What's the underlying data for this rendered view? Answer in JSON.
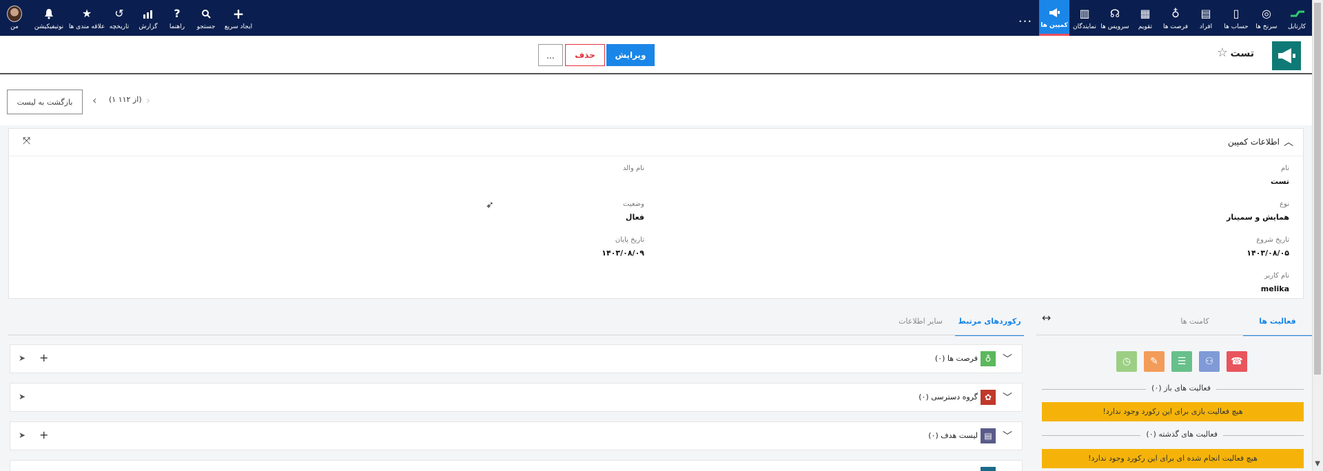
{
  "nav": {
    "right_items": [
      {
        "label": "کارتابل",
        "icon": "dashboard-icon"
      },
      {
        "label": "سرنخ ها",
        "icon": "target-icon"
      },
      {
        "label": "حساب ها",
        "icon": "building-icon"
      },
      {
        "label": "افراد",
        "icon": "contact-card-icon"
      },
      {
        "label": "فرصت ها",
        "icon": "lightbulb-icon"
      },
      {
        "label": "تقویم",
        "icon": "calendar-icon"
      },
      {
        "label": "سرویس ها",
        "icon": "headset-icon"
      },
      {
        "label": "نمایندگان",
        "icon": "agents-icon"
      },
      {
        "label": "کمپین ها",
        "icon": "megaphone-icon"
      }
    ],
    "left_items": [
      {
        "label": "من",
        "icon": "avatar"
      },
      {
        "label": "نوتیفیکیشن",
        "icon": "bell-icon"
      },
      {
        "label": "علاقه مندی ها",
        "icon": "star-icon"
      },
      {
        "label": "تاریخچه",
        "icon": "history-icon"
      },
      {
        "label": "گزارش",
        "icon": "chart-icon"
      },
      {
        "label": "راهنما",
        "icon": "help-icon"
      },
      {
        "label": "جستجو",
        "icon": "search-icon"
      },
      {
        "label": "ایجاد سریع",
        "icon": "plus-icon"
      }
    ],
    "more": "..."
  },
  "header": {
    "title": "تست",
    "edit_label": "ویرایش",
    "delete_label": "حذف",
    "more_label": "..."
  },
  "pager": {
    "back_label": "بازگشت به لیست",
    "count": "(۱ از ۱۱۲)"
  },
  "panel": {
    "title": "اطلاعات کمپین",
    "fields": {
      "name_label": "نام",
      "name_value": "تست",
      "type_label": "نوع",
      "type_value": "همایش و سمینار",
      "start_label": "تاریخ شروع",
      "start_value": "۱۴۰۳/۰۸/۰۵",
      "user_label": "نام کاربر",
      "user_value": "melika",
      "parent_label": "نام والد",
      "parent_value": "",
      "status_label": "وضعیت",
      "status_value": "فعال",
      "end_label": "تاریخ پایان",
      "end_value": "۱۴۰۳/۰۸/۰۹"
    }
  },
  "tabs": {
    "activities": "فعالیت ها",
    "comments": "کامنت ها",
    "related": "رکوردهای مرتبط",
    "other": "سایر اطلاعات"
  },
  "related": [
    {
      "title": "فرصت ها (۰)",
      "color": "#5cb85c"
    },
    {
      "title": "گروه دسترسی (۰)",
      "color": "#c0392b"
    },
    {
      "title": "لیست هدف (۰)",
      "color": "#5a5a8a"
    }
  ],
  "activities": {
    "open_title": "فعالیت های باز (۰)",
    "open_notice": "هیچ فعالیت بازی برای این رکورد وجود ندارد!",
    "past_title": "فعالیت های گذشته (۰)",
    "past_notice": "هیچ فعالیت انجام شده ای برای این رکورد وجود ندارد!"
  }
}
